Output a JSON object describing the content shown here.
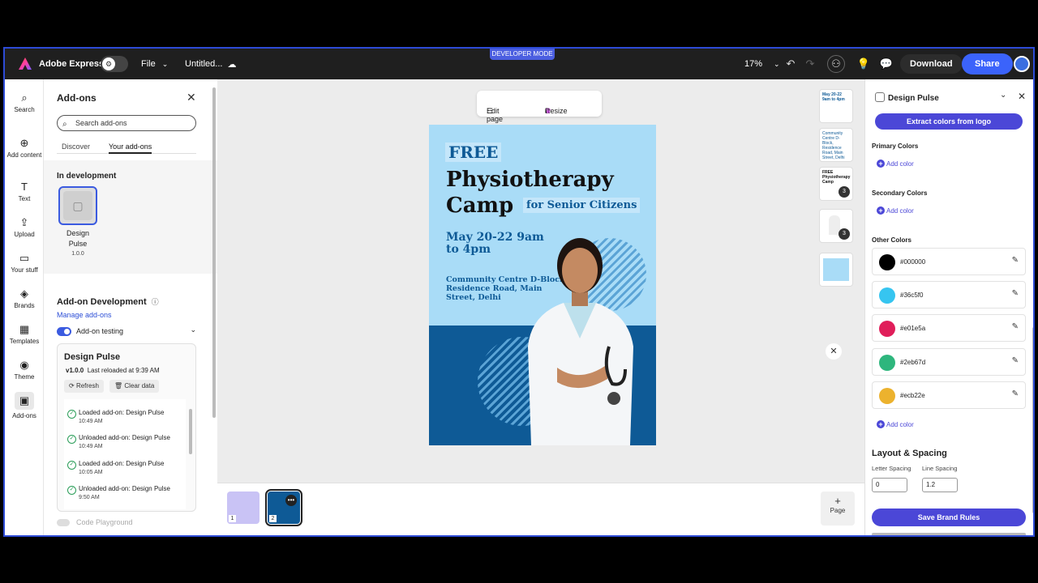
{
  "topbar": {
    "dev_mode": "DEVELOPER MODE",
    "app_name": "Adobe Express",
    "file_menu": "File",
    "doc_title": "Untitled...",
    "zoom": "17%",
    "download": "Download",
    "share": "Share"
  },
  "rail": [
    {
      "label": "Search",
      "icon": "search-icon"
    },
    {
      "label": "Add content",
      "icon": "plus-icon"
    },
    {
      "label": "Text",
      "icon": "text-icon"
    },
    {
      "label": "Upload",
      "icon": "upload-icon"
    },
    {
      "label": "Your stuff",
      "icon": "folder-icon"
    },
    {
      "label": "Brands",
      "icon": "brand-icon"
    },
    {
      "label": "Templates",
      "icon": "template-icon"
    },
    {
      "label": "Theme",
      "icon": "palette-icon"
    },
    {
      "label": "Add-ons",
      "icon": "addon-icon"
    }
  ],
  "addons": {
    "title": "Add-ons",
    "search_placeholder": "Search add-ons",
    "tab_discover": "Discover",
    "tab_yours": "Your add-ons",
    "in_dev": "In development",
    "addon_name": "Design Pulse",
    "addon_version": "1.0.0",
    "dev_heading": "Add-on Development",
    "manage_link": "Manage add-ons",
    "testing_label": "Add-on testing",
    "card_title": "Design Pulse",
    "card_version": "v1.0.0",
    "card_reloaded": "Last reloaded at 9:39 AM",
    "refresh": "Refresh",
    "clear_data": "Clear data",
    "logs": [
      {
        "text": "Loaded add-on: Design Pulse",
        "time": "10:49 AM"
      },
      {
        "text": "Unloaded add-on: Design Pulse",
        "time": "10:49 AM"
      },
      {
        "text": "Loaded add-on: Design Pulse",
        "time": "10:05 AM"
      },
      {
        "text": "Unloaded add-on: Design Pulse",
        "time": "9:50 AM"
      }
    ],
    "code_playground": "Code Playground"
  },
  "canvas": {
    "edit_page": "Edit page",
    "resize": "Resize",
    "poster": {
      "free": "FREE",
      "title": "Physiotherapy Camp",
      "subtitle": "for Senior Citizens",
      "date": "May 20-22 9am to 4pm",
      "venue": "Community Centre D-Block, Residence Road, Main Street, Delhi"
    },
    "thumbs": [
      {
        "text": "May 20-22 9am to 4pm"
      },
      {
        "text": "Community Centre D-Block, Residence Road, Main Street, Delhi"
      },
      {
        "text": "FREE Physiotherapy Camp",
        "badge": "3"
      },
      {
        "text": "",
        "badge": "3"
      }
    ],
    "page_numbers": [
      "1",
      "2"
    ],
    "add_page": "Page"
  },
  "right": {
    "title": "Design Pulse",
    "extract": "Extract colors from logo",
    "primary": "Primary Colors",
    "secondary": "Secondary Colors",
    "other": "Other Colors",
    "add_color": "Add color",
    "colors": [
      {
        "hex": "#000000",
        "swatch": "#000000"
      },
      {
        "hex": "#36c5f0",
        "swatch": "#36c5f0"
      },
      {
        "hex": "#e01e5a",
        "swatch": "#e01e5a"
      },
      {
        "hex": "#2eb67d",
        "swatch": "#2eb67d"
      },
      {
        "hex": "#ecb22e",
        "swatch": "#ecb22e"
      }
    ],
    "layout_heading": "Layout & Spacing",
    "letter_spacing_label": "Letter Spacing",
    "line_spacing_label": "Line Spacing",
    "letter_spacing": "0",
    "line_spacing": "1.2",
    "save": "Save Brand Rules"
  }
}
